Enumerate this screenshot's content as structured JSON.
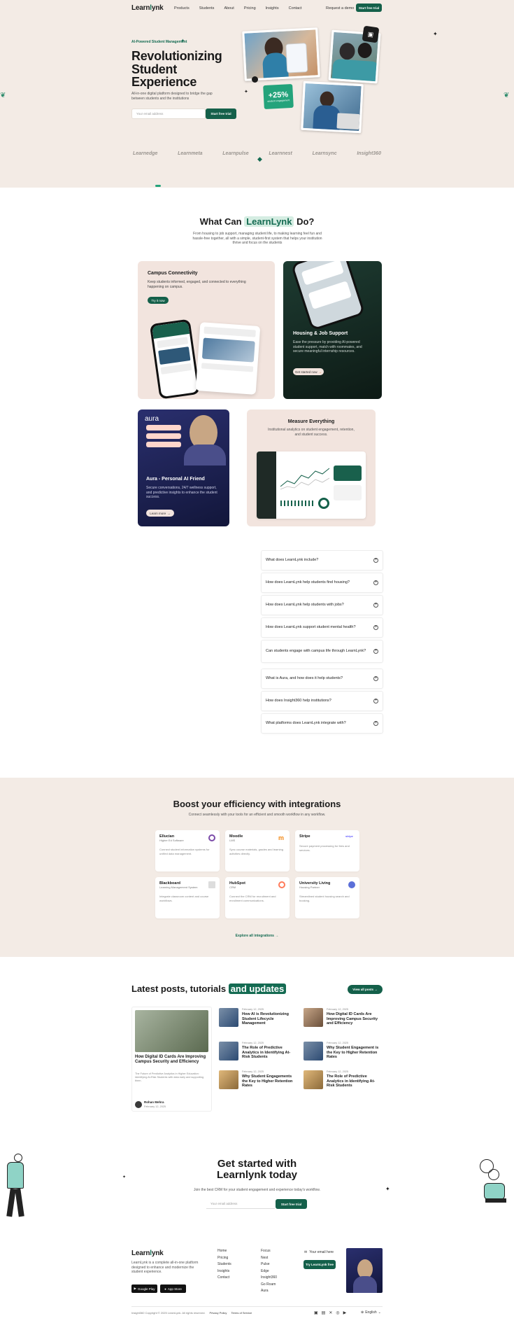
{
  "brand": {
    "logo_main": "Learn",
    "logo_i": "l",
    "logo_end": "ynk",
    "accent": "#146b52",
    "cream": "#f3ebe5"
  },
  "nav": {
    "items": [
      "Products",
      "Students",
      "About",
      "Pricing",
      "Insights",
      "Contact"
    ],
    "request_demo": "Request a demo",
    "start_trial": "Start free trial"
  },
  "hero": {
    "tag": "AI-Powered Student Management",
    "title_line1": "Revolutionizing",
    "title_line2": "Student",
    "title_line3": "Experience",
    "subtitle": "All-in-one digital platform designed to bridge the gap between students and the institutions",
    "email_placeholder": "Your email address",
    "cta": "Start free trial",
    "stat": "+25%",
    "stat_label": "student engagement"
  },
  "partners": [
    "Learnedge",
    "Learnmeta",
    "Learnpulse",
    "Learnnest",
    "Learnsync",
    "Insight360"
  ],
  "features": {
    "title_pre": "What Can",
    "title_brand": "LearnLynk",
    "title_post": "Do?",
    "subtitle": "From housing to job support, managing student life, to making learning feel fun and hassle-free together, all with a simple, student-first system that helps your institution thrive and focus on the students",
    "campus": {
      "title": "Campus Connectivity",
      "text": "Keep students informed, engaged, and connected to everything happening on campus.",
      "btn": "Try it now"
    },
    "housing": {
      "title": "Housing & Job Support",
      "text": "Ease the pressure by providing AI-powered student support, match with roommates, and secure meaningful internship resources.",
      "btn": "Get started now"
    },
    "aura": {
      "title": "Aura - Personal AI Friend",
      "text": "Secure conversations, 24/7 wellness support, and predictive insights to enhance the student success.",
      "btn": "Learn more",
      "label": "aura"
    },
    "measure": {
      "title": "Measure Everything",
      "text": "Institutional analytics on student engagement, retention, and student success."
    }
  },
  "faq": {
    "items": [
      "What does LearnLynk include?",
      "How does LearnLynk help students find housing?",
      "How does LearnLynk help students with jobs?",
      "How does LearnLynk support student mental health?",
      "Can students engage with campus life through LearnLynk?",
      "What is Aura, and how does it help students?",
      "How does Insight360 help institutions?",
      "What platforms does LearnLynk integrate with?"
    ]
  },
  "integrations": {
    "title": "Boost your efficiency with integrations",
    "subtitle": "Connect seamlessly with your tools for an efficient and smooth workflow in any workflow.",
    "items": [
      {
        "name": "Ellucian",
        "sub": "Higher Ed Software",
        "desc": "Connect student information systems for unified data management.",
        "color": "#7b4aa8"
      },
      {
        "name": "Moodle",
        "sub": "LMS",
        "desc": "Sync course materials, grades and learning activities directly.",
        "color": "#f28a1a"
      },
      {
        "name": "Stripe",
        "sub": "",
        "desc": "Secure payment processing for fees and services.",
        "color": "#635bff"
      },
      {
        "name": "Blackboard",
        "sub": "Learning Management System",
        "desc": "Integrate classroom content and course workflows.",
        "color": "#999999"
      },
      {
        "name": "HubSpot",
        "sub": "CRM",
        "desc": "Connect the CRM for recruitment and enrollment communications.",
        "color": "#ff7a59"
      },
      {
        "name": "University Living",
        "sub": "Housing Partner",
        "desc": "Streamlined student housing search and booking.",
        "color": "#5b6fd8"
      }
    ],
    "explore": "Explore all integrations →"
  },
  "posts": {
    "title_pre": "Latest posts, tutorials",
    "title_hl": "and updates",
    "view_all": "View all posts →",
    "featured": {
      "title": "How Digital ID Cards Are Improving Campus Security and Efficiency",
      "excerpt": "The Future of Predictive Analytics in Higher Education: Identifying At-Risk Students with data early and supporting them.",
      "author": "Rohan Mehra",
      "date": "February 12, 2025"
    },
    "list": [
      {
        "date": "February 12, 2025",
        "title": "How AI is Revolutionizing Student Lifecycle Management"
      },
      {
        "date": "February 12, 2025",
        "title": "The Role of Predictive Analytics in Identifying At-Risk Students"
      },
      {
        "date": "February 12, 2025",
        "title": "Why Student Engagements the Key to Higher Retention Rates"
      },
      {
        "date": "February 12, 2025",
        "title": "How Digital ID Cards Are Improving Campus Security and Efficiency"
      },
      {
        "date": "February 12, 2025",
        "title": "Why Student Engagement is the Key to Higher Retention Rates"
      },
      {
        "date": "February 12, 2025",
        "title": "The Role of Predictive Analytics in Identifying At-Risk Students"
      }
    ]
  },
  "cta": {
    "title_line1": "Get started with",
    "title_line2": "Learnlynk today",
    "subtitle": "Join the best CRM for your student engagement and experience today's workflow.",
    "placeholder": "Your email address",
    "btn": "Start free trial"
  },
  "footer": {
    "desc": "LearnLynk is a complete all-in-one platform designed to enhance and modernize the student experience.",
    "google_play": "Google Play",
    "app_store": "App Store",
    "col1": [
      "Home",
      "Pricing",
      "Students",
      "Insights",
      "Contact"
    ],
    "col2": [
      "Focus",
      "Nest",
      "Pulse",
      "Edge",
      "Insight360",
      "Go Roam",
      "Aura"
    ],
    "contact_label": "Your email here",
    "btn": "Try LearnLynk free",
    "copyright": "Insight360 Copyright © 2025 LearnLynk. All rights reserved.",
    "privacy": "Privacy Policy",
    "terms": "Terms of Service",
    "language": "English"
  }
}
